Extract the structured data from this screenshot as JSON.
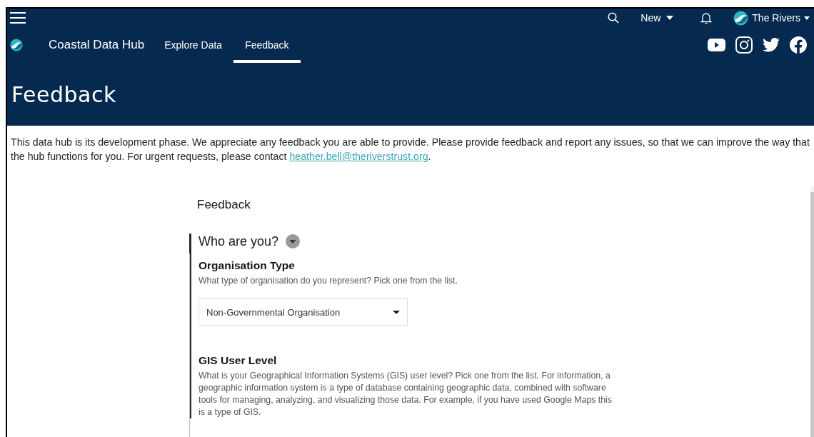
{
  "top_bar": {
    "new_button": "New",
    "account": "The Rivers"
  },
  "nav": {
    "site_title": "Coastal Data Hub",
    "links": [
      {
        "label": "Explore Data",
        "selected": false
      },
      {
        "label": "Feedback",
        "selected": true
      }
    ]
  },
  "page_title": "Feedback",
  "intro": {
    "text": "This data hub is its development phase. We appreciate any feedback you are able to provide. Please provide feedback and report any issues, so that we can improve the way that the hub functions for you. For urgent requests, please contact ",
    "link": "heather.bell@theriverstrust.org",
    "after": "."
  },
  "form": {
    "title": "Feedback",
    "section": {
      "title": "Who are you?",
      "expanded": true,
      "questions": [
        {
          "kind": "dropdown",
          "label": "Organisation Type",
          "help": "What type of organisation do you represent? Pick one from the list.",
          "value": "Non-Governmental Organisation"
        },
        {
          "kind": "heading",
          "label": "GIS User Level",
          "help": "What is your Geographical Information Systems (GIS) user level? Pick one from the list. For information, a geographic information system is a type of database containing geographic data, combined with software tools for managing, analyzing, and visualizing those data. For example, if you have used Google Maps this is a type of GIS."
        }
      ]
    }
  }
}
